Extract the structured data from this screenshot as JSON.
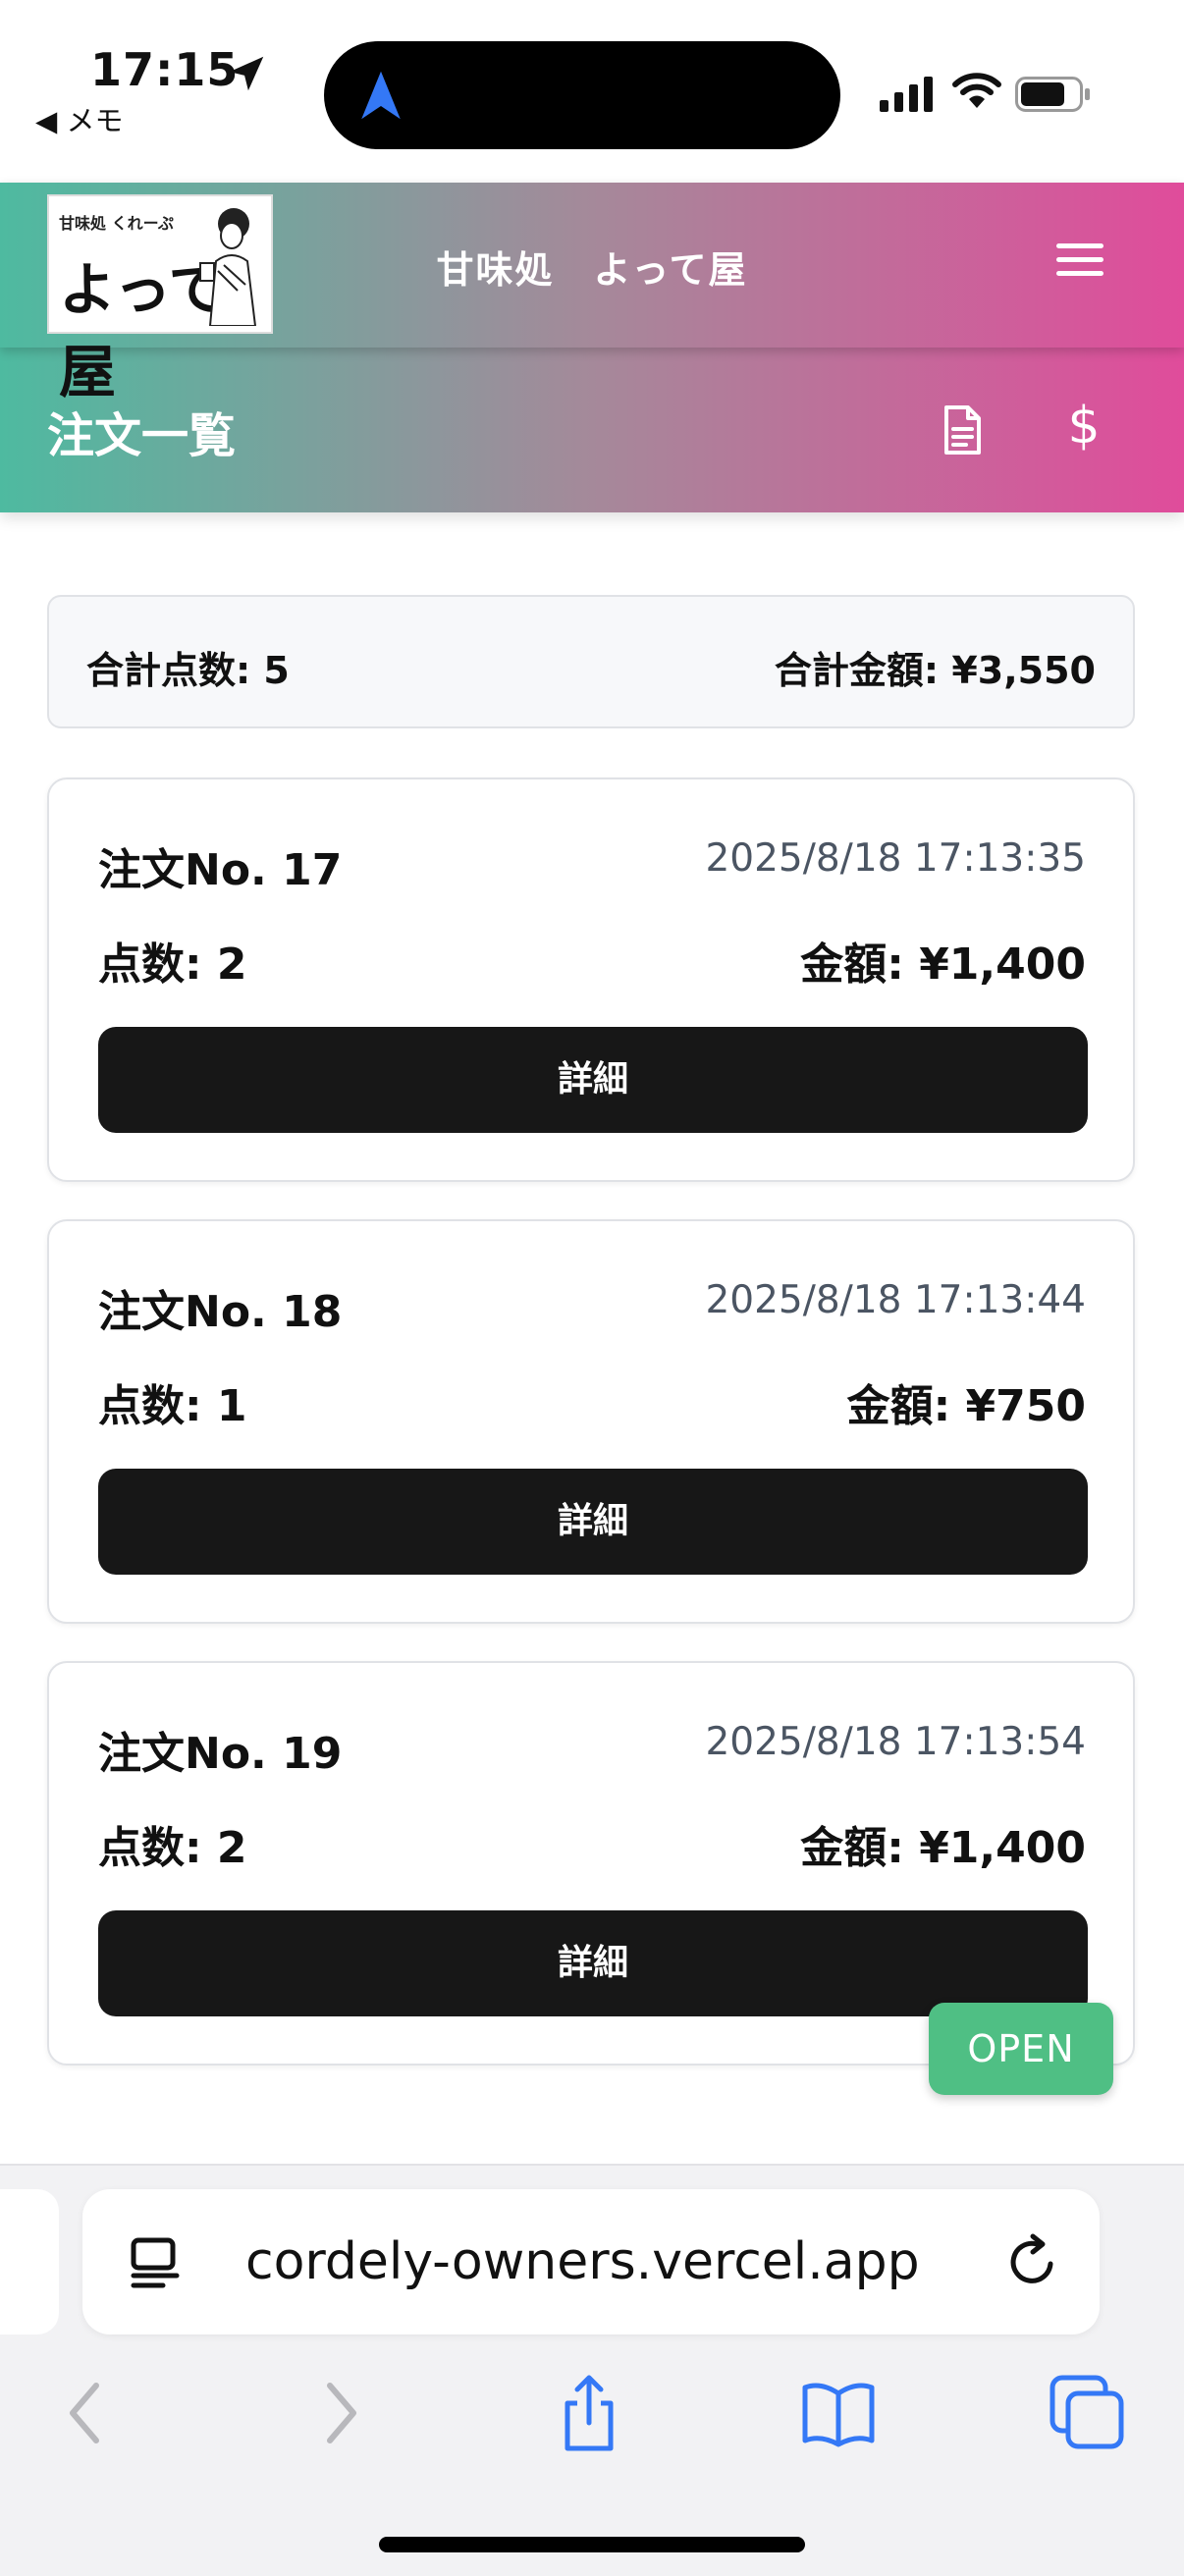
{
  "status_bar": {
    "time": "17:15",
    "back_app": "◀ メモ"
  },
  "header": {
    "logo_mark": "甘味処 くれーぷ",
    "logo_brand": "よって屋",
    "app_title": "甘味処　よって屋"
  },
  "subheader": {
    "title": "注文一覧",
    "dollar_symbol": "$"
  },
  "summary": {
    "total_items": "合計点数: 5",
    "total_amount": "合計金額: ¥3,550"
  },
  "orders": [
    {
      "no": "注文No. 17",
      "datetime": "2025/8/18 17:13:35",
      "qty": "点数: 2",
      "amount": "金額: ¥1,400",
      "button": "詳細"
    },
    {
      "no": "注文No. 18",
      "datetime": "2025/8/18 17:13:44",
      "qty": "点数: 1",
      "amount": "金額: ¥750",
      "button": "詳細"
    },
    {
      "no": "注文No. 19",
      "datetime": "2025/8/18 17:13:54",
      "qty": "点数: 2",
      "amount": "金額: ¥1,400",
      "button": "詳細"
    }
  ],
  "badge": {
    "label": "OPEN"
  },
  "browser": {
    "url": "cordely-owners.vercel.app"
  },
  "colors": {
    "gradient_start": "#4ebaa0",
    "gradient_end": "#e04c9b",
    "button_dark": "#171717",
    "open_badge": "#4fbf84",
    "ios_blue": "#3478f6"
  }
}
